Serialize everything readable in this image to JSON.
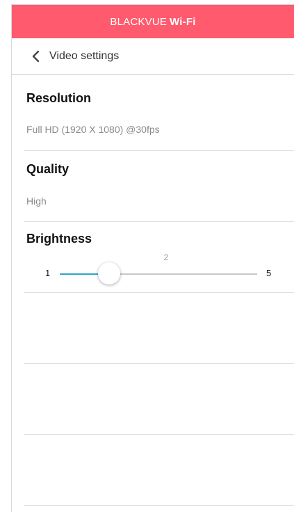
{
  "header": {
    "brand": "BLACKVUE",
    "brand_bold": "Wi-Fi",
    "color": "#ff5a6e"
  },
  "nav": {
    "back_icon": "chevron-left-icon",
    "title": "Video settings"
  },
  "settings": {
    "resolution": {
      "title": "Resolution",
      "value": "Full HD (1920 X 1080) @30fps"
    },
    "quality": {
      "title": "Quality",
      "value": "High"
    },
    "brightness": {
      "title": "Brightness",
      "min": "1",
      "max": "5",
      "current": "2",
      "min_value": 1,
      "max_value": 5,
      "current_value": 2,
      "accent": "#2aa8c8"
    }
  }
}
